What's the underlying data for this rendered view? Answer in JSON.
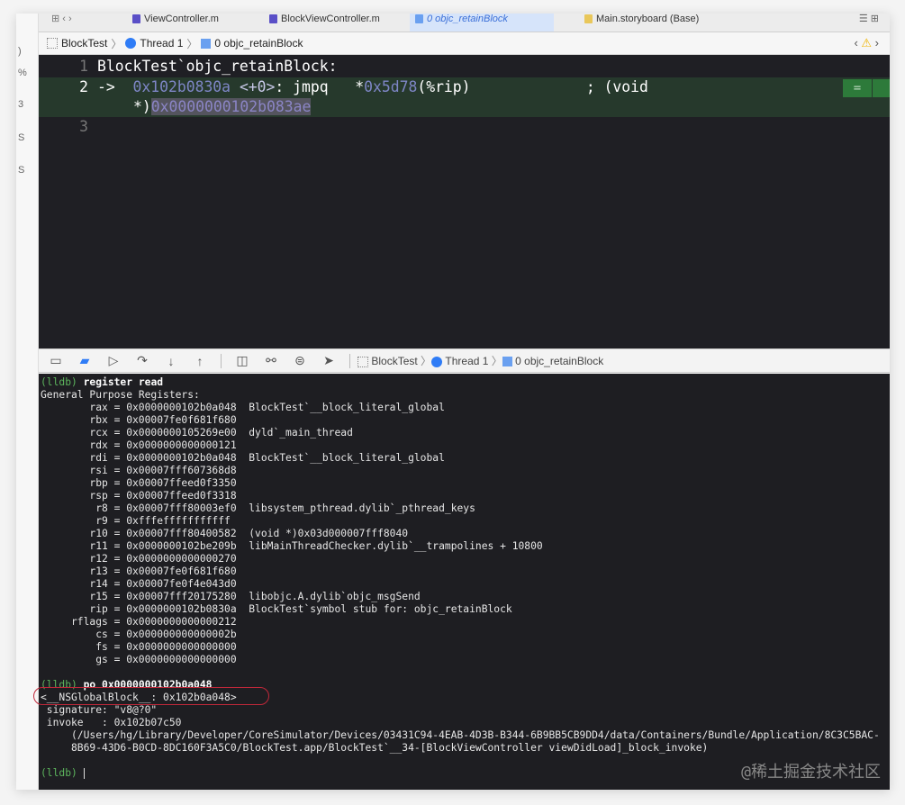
{
  "tabs": [
    {
      "label": "ViewController.m",
      "icon": "m-file-icon"
    },
    {
      "label": "BlockViewController.m",
      "icon": "m-file-icon"
    },
    {
      "label": "0 objc_retainBlock",
      "icon": "frame-icon",
      "active": true
    },
    {
      "label": "Main.storyboard (Base)",
      "icon": "storyboard-icon"
    }
  ],
  "breadcrumb": {
    "project": "BlockTest",
    "thread": "Thread 1",
    "frame": "0 objc_retainBlock"
  },
  "editor": {
    "lines": [
      {
        "num": "1",
        "text": "BlockTest`objc_retainBlock:"
      },
      {
        "num": "2",
        "arrow": "->",
        "addr": "0x102b0830a",
        "offset": "<+0>",
        "instr": ": jmpq   *",
        "operand": "0x5d78",
        "reg": "(%rip)",
        "comment": "             ; (void",
        "cont": "*)",
        "target": "0x0000000102b083ae"
      },
      {
        "num": "3",
        "text": ""
      }
    ],
    "current_line_color": "#26392c"
  },
  "debug_bar": {
    "project": "BlockTest",
    "thread": "Thread 1",
    "frame": "0 objc_retainBlock"
  },
  "console": {
    "prompt": "(lldb)",
    "cmd1": "register read",
    "header": "General Purpose Registers:",
    "registers": [
      [
        "rax",
        "0x0000000102b0a048",
        "BlockTest`__block_literal_global"
      ],
      [
        "rbx",
        "0x00007fe0f681f680",
        ""
      ],
      [
        "rcx",
        "0x0000000105269e00",
        "dyld`_main_thread"
      ],
      [
        "rdx",
        "0x0000000000000121",
        ""
      ],
      [
        "rdi",
        "0x0000000102b0a048",
        "BlockTest`__block_literal_global"
      ],
      [
        "rsi",
        "0x00007fff607368d8",
        ""
      ],
      [
        "rbp",
        "0x00007ffeed0f3350",
        ""
      ],
      [
        "rsp",
        "0x00007ffeed0f3318",
        ""
      ],
      [
        "r8",
        "0x00007fff80003ef0",
        "libsystem_pthread.dylib`_pthread_keys"
      ],
      [
        "r9",
        "0xfffefffffffffff",
        ""
      ],
      [
        "r10",
        "0x00007fff80400582",
        "(void *)0x03d000007fff8040"
      ],
      [
        "r11",
        "0x0000000102be209b",
        "libMainThreadChecker.dylib`__trampolines + 10800"
      ],
      [
        "r12",
        "0x0000000000000270",
        ""
      ],
      [
        "r13",
        "0x00007fe0f681f680",
        ""
      ],
      [
        "r14",
        "0x00007fe0f4e043d0",
        ""
      ],
      [
        "r15",
        "0x00007fff20175280",
        "libobjc.A.dylib`objc_msgSend"
      ],
      [
        "rip",
        "0x0000000102b0830a",
        "BlockTest`symbol stub for: objc_retainBlock"
      ],
      [
        "rflags",
        "0x0000000000000212",
        ""
      ],
      [
        "cs",
        "0x000000000000002b",
        ""
      ],
      [
        "fs",
        "0x0000000000000000",
        ""
      ],
      [
        "gs",
        "0x0000000000000000",
        ""
      ]
    ],
    "cmd2": "po 0x0000000102b0a048",
    "out": [
      "<__NSGlobalBlock__: 0x102b0a048>",
      " signature: \"v8@?0\"",
      " invoke   : 0x102b07c50",
      "     (/Users/hg/Library/Developer/CoreSimulator/Devices/03431C94-4EAB-4D3B-B344-6B9BB5CB9DD4/data/Containers/Bundle/Application/8C3C5BAC-",
      "     8B69-43D6-B0CD-8DC160F3A5C0/BlockTest.app/BlockTest`__34-[BlockViewController viewDidLoad]_block_invoke)"
    ],
    "annotation_color": "#c0283a"
  },
  "watermark": "@稀土掘金技术社区"
}
